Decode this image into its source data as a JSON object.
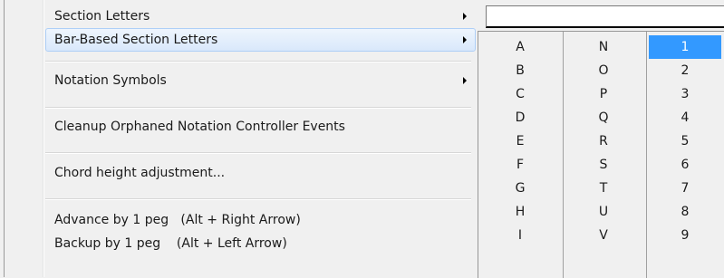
{
  "menu": {
    "section_letters": "Section Letters",
    "bar_based_section_letters": "Bar-Based Section Letters",
    "notation_symbols": "Notation Symbols",
    "cleanup": "Cleanup Orphaned Notation Controller Events",
    "chord_height": "Chord height adjustment...",
    "advance": "Advance by 1 peg   (Alt + Right Arrow)",
    "backup": "Backup by 1 peg    (Alt + Left Arrow)"
  },
  "submenu": {
    "col1": [
      "A",
      "B",
      "C",
      "D",
      "E",
      "F",
      "G",
      "H",
      "I"
    ],
    "col2": [
      "N",
      "O",
      "P",
      "Q",
      "R",
      "S",
      "T",
      "U",
      "V"
    ],
    "col3": [
      "1",
      "2",
      "3",
      "4",
      "5",
      "6",
      "7",
      "8",
      "9"
    ],
    "selected": "1"
  },
  "colors": {
    "selection": "#3399ff",
    "hover": "#d9e8fb"
  }
}
